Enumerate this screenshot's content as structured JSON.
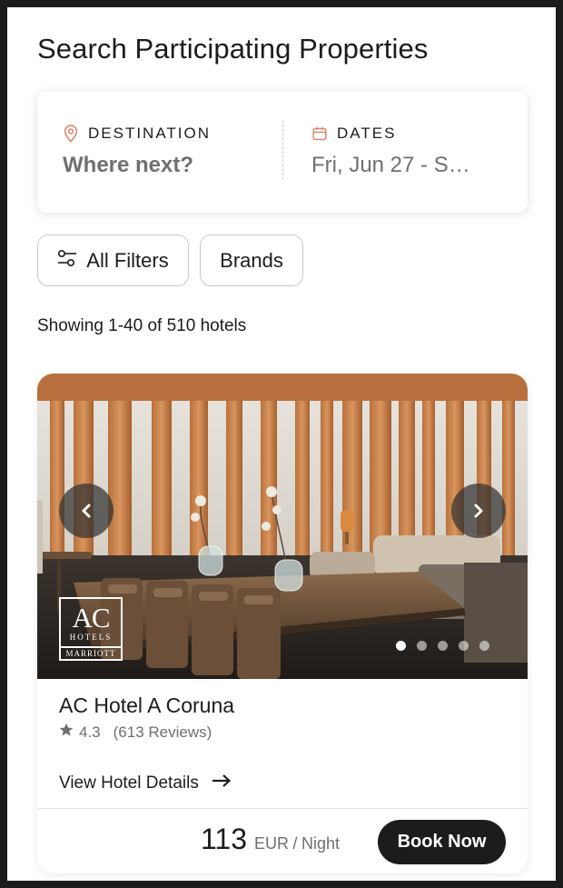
{
  "page": {
    "title": "Search Participating Properties"
  },
  "search": {
    "destination": {
      "label": "DESTINATION",
      "value": "Where next?",
      "icon": "map-pin-icon"
    },
    "dates": {
      "label": "DATES",
      "value": "Fri, Jun 27 - S…",
      "icon": "calendar-icon"
    },
    "accent_color": "#e0866a"
  },
  "filters": {
    "all_filters_label": "All Filters",
    "all_filters_icon": "sliders-icon",
    "brands_label": "Brands"
  },
  "results": {
    "summary": "Showing 1-40 of 510 hotels"
  },
  "hotel": {
    "name": "AC Hotel A Coruna",
    "rating": "4.3",
    "reviews": "(613 Reviews)",
    "details_link": "View Hotel Details",
    "price_amount": "113",
    "price_currency": "EUR",
    "price_separator": "/",
    "price_unit": "Night",
    "book_label": "Book Now",
    "carousel": {
      "total_slides": 5,
      "active_slide": 1
    },
    "brand_logo": {
      "line1": "AC",
      "line2": "HOTELS",
      "line3": "MARRIOTT"
    }
  }
}
